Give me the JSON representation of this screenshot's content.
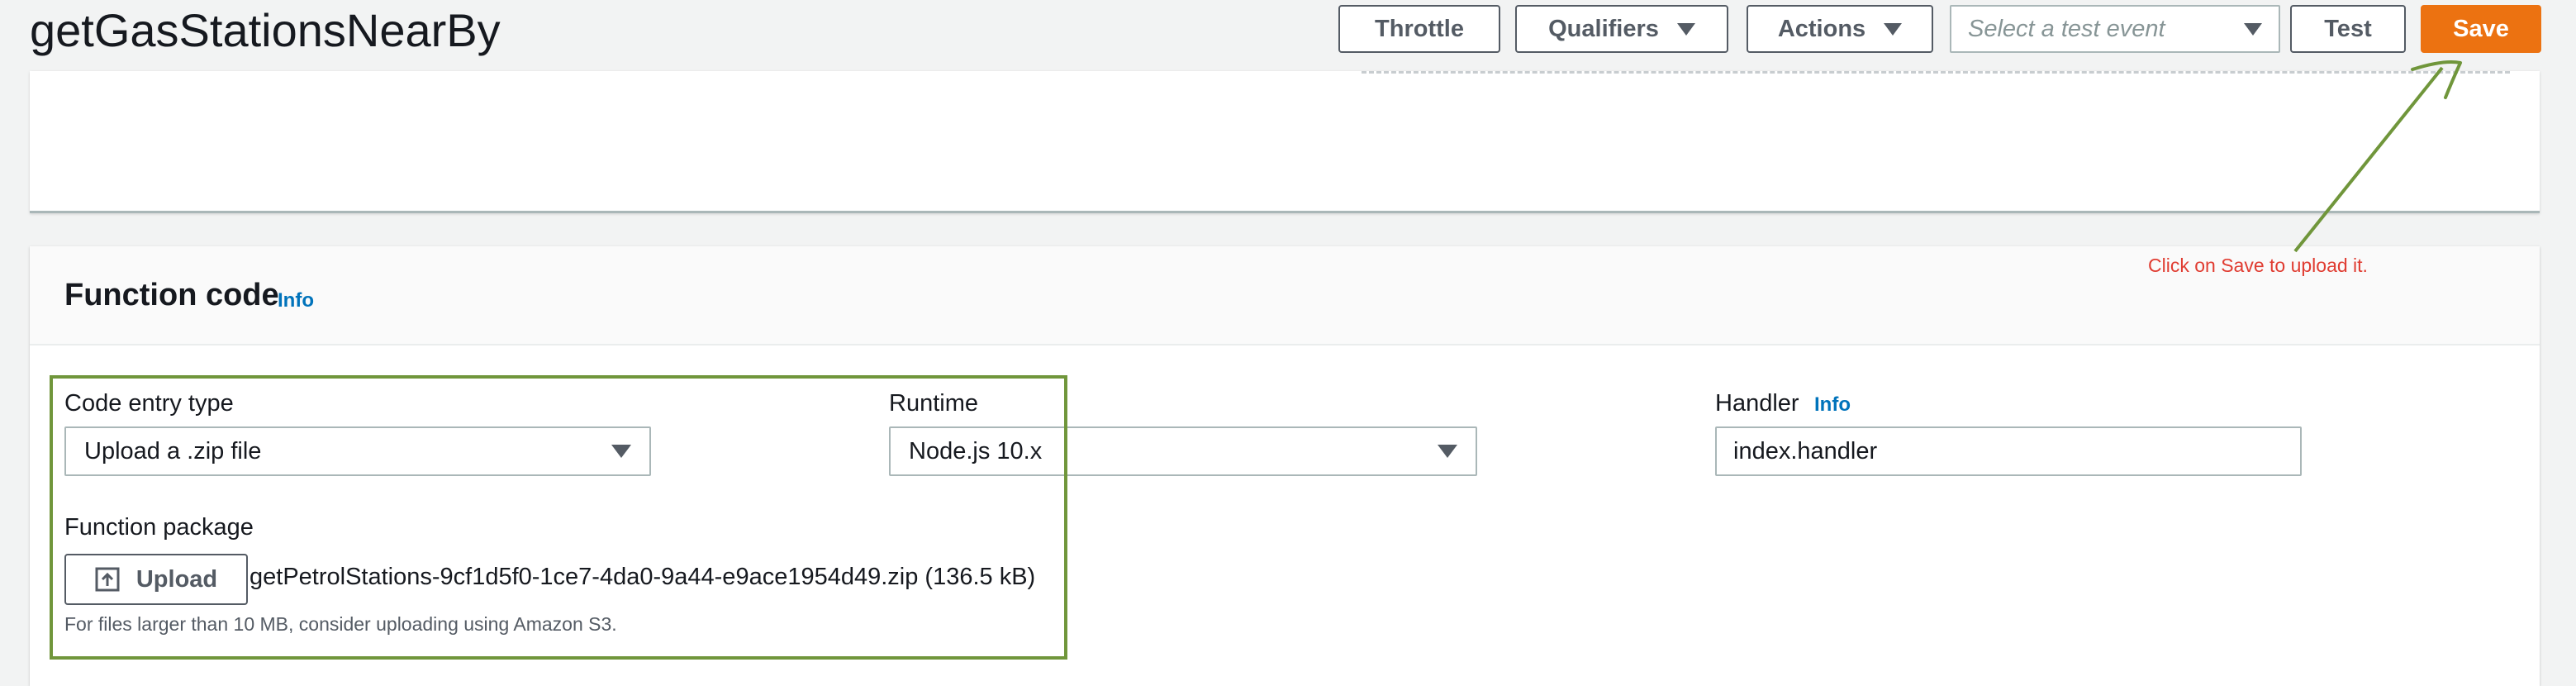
{
  "header": {
    "title": "getGasStationsNearBy",
    "throttle_label": "Throttle",
    "qualifiers_label": "Qualifiers",
    "actions_label": "Actions",
    "test_event_placeholder": "Select a test event",
    "test_label": "Test",
    "save_label": "Save"
  },
  "function_code": {
    "title": "Function code",
    "info_label": "Info",
    "code_entry_type": {
      "label": "Code entry type",
      "value": "Upload a .zip file"
    },
    "runtime": {
      "label": "Runtime",
      "value": "Node.js 10.x"
    },
    "handler": {
      "label": "Handler",
      "info_label": "Info",
      "value": "index.handler"
    },
    "function_package": {
      "label": "Function package",
      "upload_label": "Upload",
      "file_name": "getPetrolStations-9cf1d5f0-1ce7-4da0-9a44-e9ace1954d49.zip (136.5 kB)",
      "hint": "For files larger than 10 MB, consider uploading using Amazon S3."
    }
  },
  "annotation": {
    "text": "Click on Save to upload it.",
    "color": "#e03c31",
    "arrow_color": "#70963b",
    "highlight_color": "#70963b"
  },
  "colors": {
    "accent": "#ec7211",
    "link": "#0073bb",
    "page_bg": "#f2f3f3"
  },
  "icons": {
    "dropdown": "caret-down-icon",
    "upload": "upload-icon"
  }
}
